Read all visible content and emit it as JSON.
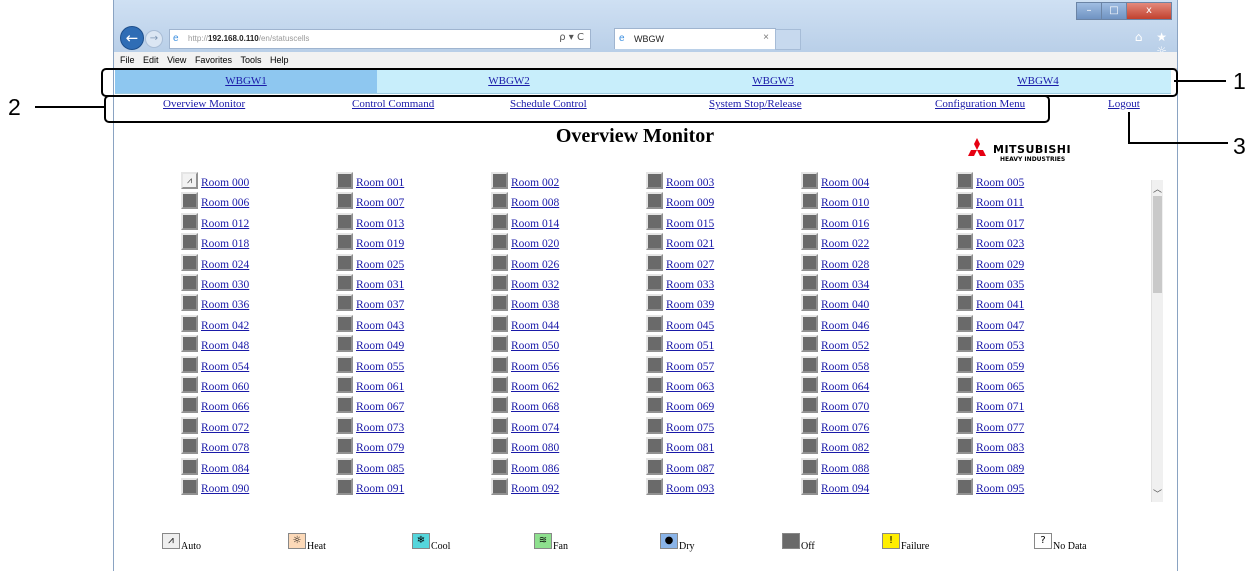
{
  "browser": {
    "url_prefix": "http://",
    "url_host": "192.168.0.110",
    "url_path": "/en/statuscells",
    "search_refresh": "ρ ▾ C",
    "tab_title": "WBGW",
    "tab_close": "×",
    "menu": [
      "File",
      "Edit",
      "View",
      "Favorites",
      "Tools",
      "Help"
    ],
    "window_buttons": {
      "min": "–",
      "max": "□",
      "close": "x"
    },
    "toolbar_icons": "⌂ ★ ☼"
  },
  "wbgw_tabs": [
    "WBGW1",
    "WBGW2",
    "WBGW3",
    "WBGW4"
  ],
  "selected_wbgw": "WBGW1",
  "menu_links": {
    "overview": "Overview Monitor",
    "control": "Control Command",
    "schedule": "Schedule Control",
    "system": "System Stop/Release",
    "config": "Configuration Menu",
    "logout": "Logout"
  },
  "page_title": "Overview Monitor",
  "logo": {
    "name": "MITSUBISHI",
    "sub": "HEAVY INDUSTRIES",
    "color": "#e60012"
  },
  "rooms": [
    "Room 000",
    "Room 001",
    "Room 002",
    "Room 003",
    "Room 004",
    "Room 005",
    "Room 006",
    "Room 007",
    "Room 008",
    "Room 009",
    "Room 010",
    "Room 011",
    "Room 012",
    "Room 013",
    "Room 014",
    "Room 015",
    "Room 016",
    "Room 017",
    "Room 018",
    "Room 019",
    "Room 020",
    "Room 021",
    "Room 022",
    "Room 023",
    "Room 024",
    "Room 025",
    "Room 026",
    "Room 027",
    "Room 028",
    "Room 029",
    "Room 030",
    "Room 031",
    "Room 032",
    "Room 033",
    "Room 034",
    "Room 035",
    "Room 036",
    "Room 037",
    "Room 038",
    "Room 039",
    "Room 040",
    "Room 041",
    "Room 042",
    "Room 043",
    "Room 044",
    "Room 045",
    "Room 046",
    "Room 047",
    "Room 048",
    "Room 049",
    "Room 050",
    "Room 051",
    "Room 052",
    "Room 053",
    "Room 054",
    "Room 055",
    "Room 056",
    "Room 057",
    "Room 058",
    "Room 059",
    "Room 060",
    "Room 061",
    "Room 062",
    "Room 063",
    "Room 064",
    "Room 065",
    "Room 066",
    "Room 067",
    "Room 068",
    "Room 069",
    "Room 070",
    "Room 071",
    "Room 072",
    "Room 073",
    "Room 074",
    "Room 075",
    "Room 076",
    "Room 077",
    "Room 078",
    "Room 079",
    "Room 080",
    "Room 081",
    "Room 082",
    "Room 083",
    "Room 084",
    "Room 085",
    "Room 086",
    "Room 087",
    "Room 088",
    "Room 089",
    "Room 090",
    "Room 091",
    "Room 092",
    "Room 093",
    "Room 094",
    "Room 095"
  ],
  "room_status": {
    "Room 000": "auto",
    "default": "off"
  },
  "legend": [
    {
      "label": "Auto",
      "icon": "auto-icon",
      "glyph": "⩘",
      "color": "#eeeeee"
    },
    {
      "label": "Heat",
      "icon": "heat-icon",
      "glyph": "☼",
      "color": "#fcd9b8"
    },
    {
      "label": "Cool",
      "icon": "cool-icon",
      "glyph": "❄",
      "color": "#55d6dc"
    },
    {
      "label": "Fan",
      "icon": "fan-icon",
      "glyph": "≋",
      "color": "#8ee08e"
    },
    {
      "label": "Dry",
      "icon": "dry-icon",
      "glyph": "●",
      "color": "#8ab4e8"
    },
    {
      "label": "Off",
      "icon": "off-icon",
      "glyph": "",
      "color": "#6a6a6a"
    },
    {
      "label": "Failure",
      "icon": "failure-icon",
      "glyph": "!",
      "color": "#ffee00"
    },
    {
      "label": "No Data",
      "icon": "nodata-icon",
      "glyph": "?",
      "color": "#ffffff"
    }
  ],
  "annotations": [
    "1",
    "2",
    "3"
  ]
}
